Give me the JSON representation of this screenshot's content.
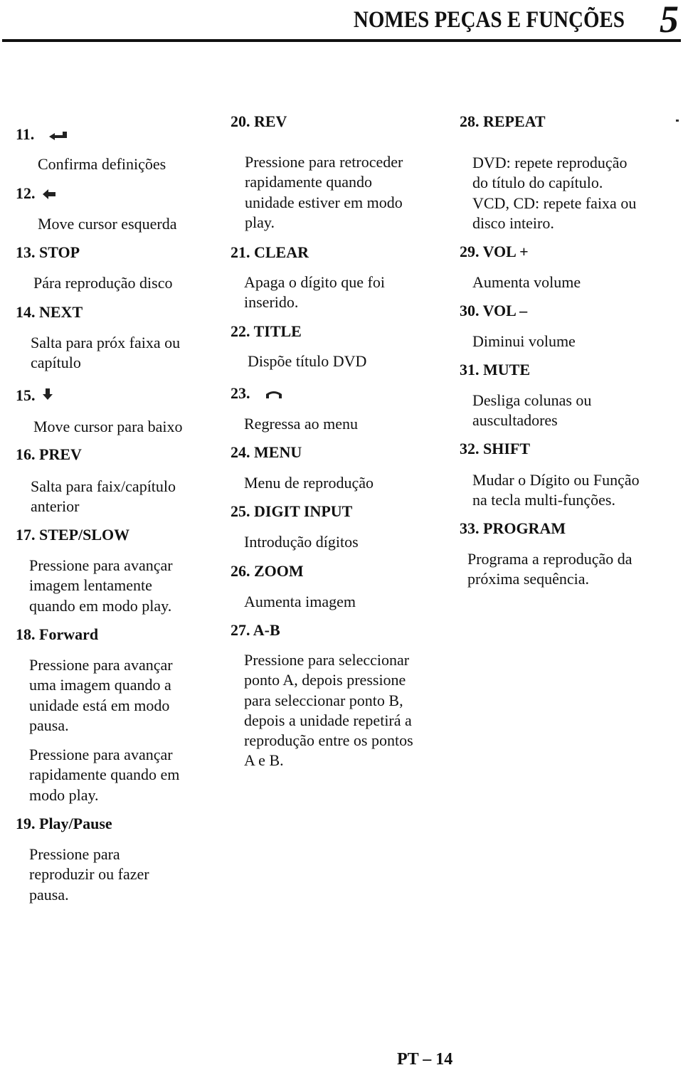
{
  "header": {
    "title": "NOMES PEÇAS E FUNÇÕES",
    "chapter": "5"
  },
  "items": {
    "i11": {
      "title": "11.",
      "icon": "enter-icon",
      "desc": "Confirma definições"
    },
    "i12": {
      "title": "12.",
      "icon": "arrow-left-icon",
      "desc": "Move cursor esquerda"
    },
    "i13": {
      "title": "13. STOP",
      "desc": "Pára reprodução disco"
    },
    "i14": {
      "title": "14. NEXT",
      "desc": "Salta para próx faixa ou\ncapítulo"
    },
    "i15": {
      "title": "15.",
      "icon": "arrow-down-icon",
      "desc": "Move cursor para baixo"
    },
    "i16": {
      "title": "16. PREV",
      "desc": "Salta para faix/capítulo\nanterior"
    },
    "i17": {
      "title": "17. STEP/SLOW",
      "desc": "Pressione para avançar\nimagem lentamente\nquando em modo play."
    },
    "i18": {
      "title": "18. Forward",
      "desc": "Pressione para avançar\numa imagem quando a\nunidade está em modo\npausa.",
      "desc2": "Pressione para avançar\nrapidamente quando em\nmodo play."
    },
    "i19": {
      "title": "19. Play/Pause",
      "desc": "Pressione para\nreproduzir ou fazer\npausa."
    },
    "i20": {
      "title": "20. REV",
      "desc": "Pressione para retroceder\nrapidamente quando\nunidade estiver em modo\nplay."
    },
    "i21": {
      "title": "21. CLEAR",
      "desc": "Apaga o dígito que foi\ninserido."
    },
    "i22": {
      "title": "22. TITLE",
      "desc": "Dispõe título DVD"
    },
    "i23": {
      "title": "23.",
      "icon": "return-icon",
      "desc": "Regressa ao menu"
    },
    "i24": {
      "title": "24. MENU",
      "desc": "Menu de reprodução"
    },
    "i25": {
      "title": "25. DIGIT INPUT",
      "desc": "Introdução dígitos"
    },
    "i26": {
      "title": "26. ZOOM",
      "desc": "Aumenta imagem"
    },
    "i27": {
      "title": "27. A-B",
      "desc": "Pressione para seleccionar\nponto A, depois pressione\npara seleccionar ponto B,\ndepois a unidade repetirá a\nreprodução entre os pontos\nA e B."
    },
    "i28": {
      "title": "28. REPEAT",
      "desc": "DVD: repete reprodução\ndo título do capítulo.\nVCD, CD: repete faixa ou\ndisco inteiro."
    },
    "i29": {
      "title": "29. VOL +",
      "desc": "Aumenta volume"
    },
    "i30": {
      "title": "30. VOL –",
      "desc": "Diminui volume"
    },
    "i31": {
      "title": "31. MUTE",
      "desc": "Desliga colunas ou\nauscultadores"
    },
    "i32": {
      "title": "32. SHIFT",
      "desc": "Mudar o Dígito ou Função\nna tecla multi-funções."
    },
    "i33": {
      "title": "33. PROGRAM",
      "desc": "Programa a reprodução da\npróxima sequência."
    }
  },
  "footer": {
    "page_label": "PT – 14"
  }
}
